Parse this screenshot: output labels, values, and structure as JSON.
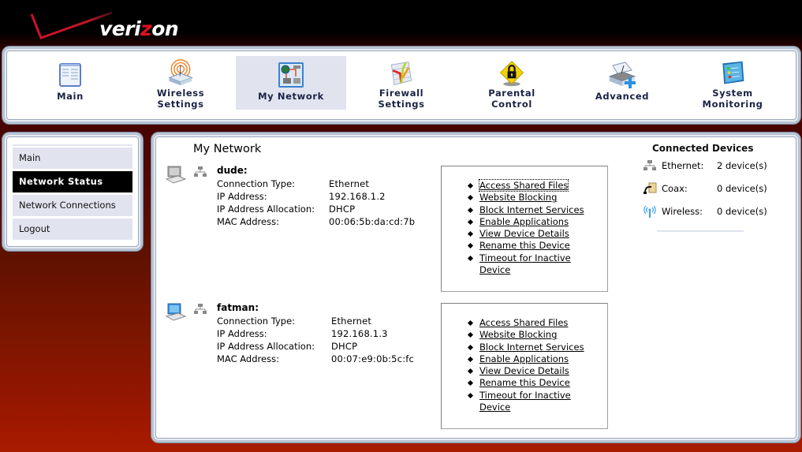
{
  "brand": {
    "logo_text_pre": "veri",
    "logo_text_z": "z",
    "logo_text_post": "on",
    "accent": "#e01020"
  },
  "topnav": {
    "items": [
      {
        "label_1": "Main",
        "label_2": "",
        "icon": "main-dashboard-icon",
        "active": false
      },
      {
        "label_1": "Wireless",
        "label_2": "Settings",
        "icon": "wireless-router-icon",
        "active": false
      },
      {
        "label_1": "My Network",
        "label_2": "",
        "icon": "my-network-icon",
        "active": true
      },
      {
        "label_1": "Firewall",
        "label_2": "Settings",
        "icon": "firewall-icon",
        "active": false
      },
      {
        "label_1": "Parental",
        "label_2": "Control",
        "icon": "parental-lock-icon",
        "active": false
      },
      {
        "label_1": "Advanced",
        "label_2": "",
        "icon": "advanced-router-icon",
        "active": false
      },
      {
        "label_1": "System",
        "label_2": "Monitoring",
        "icon": "system-monitor-icon",
        "active": false
      }
    ]
  },
  "sidebar": {
    "items": [
      {
        "label": "Main",
        "active": false
      },
      {
        "label": "Network Status",
        "active": true
      },
      {
        "label": "Network Connections",
        "active": false
      },
      {
        "label": "Logout",
        "active": false
      }
    ]
  },
  "main": {
    "title": "My Network",
    "field_labels": {
      "connection_type": "Connection Type:",
      "ip_address": "IP Address:",
      "ip_allocation": "IP Address Allocation:",
      "mac_address": "MAC Address:"
    },
    "devices": [
      {
        "name": "dude:",
        "connection_type": "Ethernet",
        "ip_address": "192.168.1.2",
        "ip_allocation": "DHCP",
        "mac_address": "00:06:5b:da:cd:7b",
        "icon": "computer-gray-icon"
      },
      {
        "name": "fatman:",
        "connection_type": "Ethernet",
        "ip_address": "192.168.1.3",
        "ip_allocation": "DHCP",
        "mac_address": "00:07:e9:0b:5c:fc",
        "icon": "computer-blue-icon"
      }
    ],
    "actions": [
      "Access Shared Files",
      "Website Blocking",
      "Block Internet Services",
      "Enable Applications",
      "View Device Details",
      "Rename this Device",
      "Timeout for Inactive Device"
    ]
  },
  "connected_devices": {
    "title": "Connected Devices",
    "rows": [
      {
        "label": "Ethernet:",
        "value": "2 device(s)",
        "icon": "ethernet-icon"
      },
      {
        "label": "Coax:",
        "value": "0 device(s)",
        "icon": "coax-icon"
      },
      {
        "label": "Wireless:",
        "value": "0 device(s)",
        "icon": "wireless-icon"
      }
    ]
  }
}
